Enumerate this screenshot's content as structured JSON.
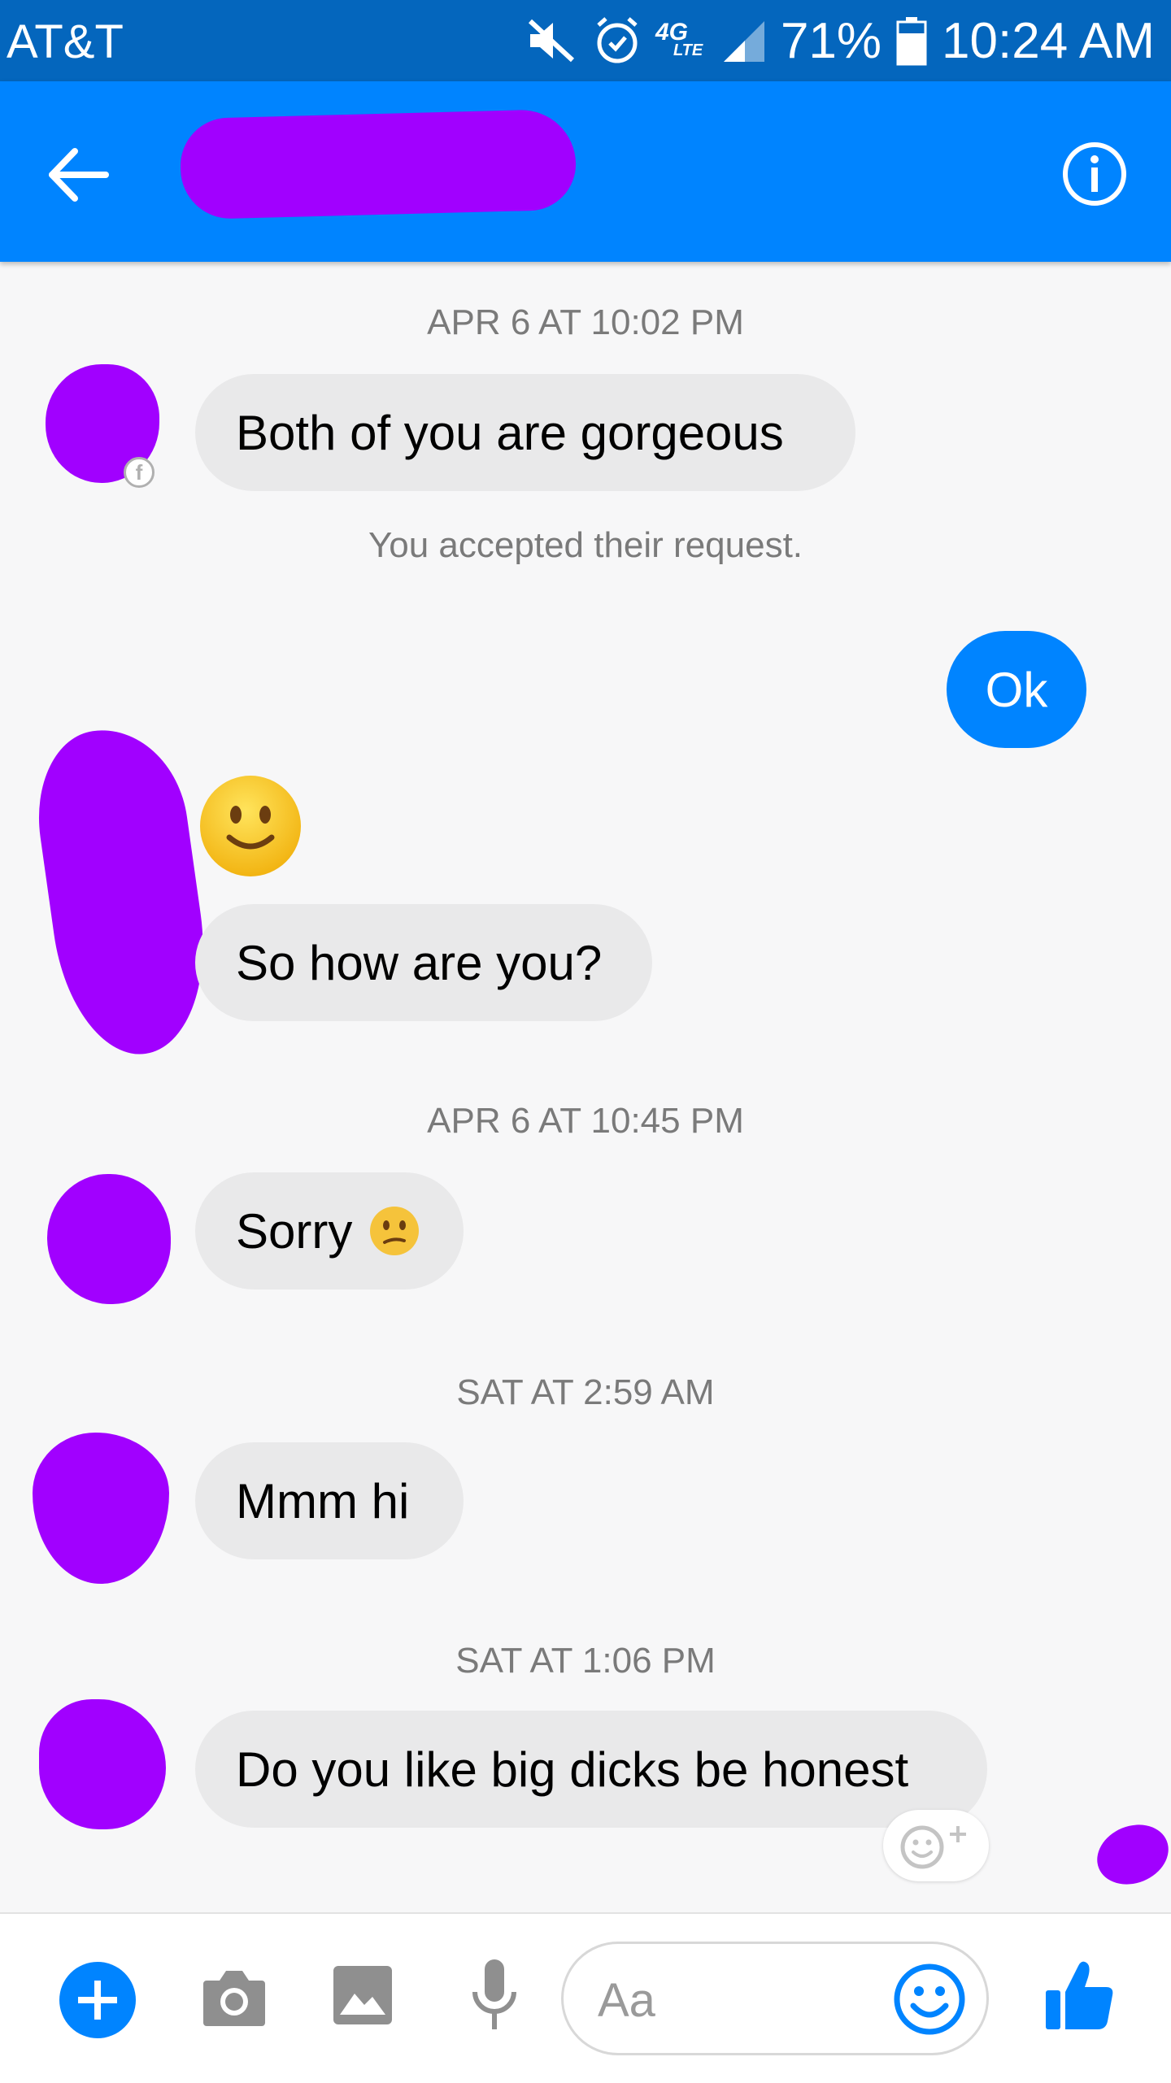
{
  "status_bar": {
    "carrier": "AT&T",
    "network": "4G",
    "network_sub": "LTE",
    "battery": "71%",
    "time": "10:24 AM",
    "icons": [
      "mute-icon",
      "alarm-icon",
      "signal-icon",
      "battery-icon"
    ]
  },
  "header": {
    "contact_name": "",
    "back_icon": "back-arrow-icon",
    "info_icon": "info-icon"
  },
  "messages": [
    {
      "type": "timestamp",
      "text": "APR 6 AT 10:02 PM"
    },
    {
      "type": "incoming",
      "text": "Both of you are gorgeous"
    },
    {
      "type": "system",
      "text": "You accepted their request."
    },
    {
      "type": "outgoing",
      "text": "Ok"
    },
    {
      "type": "incoming_emoji",
      "emoji": "slightly-smiling-face"
    },
    {
      "type": "incoming",
      "text": "So how are you?"
    },
    {
      "type": "timestamp",
      "text": "APR 6 AT 10:45 PM"
    },
    {
      "type": "incoming",
      "text": "Sorry",
      "emoji": "confused-face"
    },
    {
      "type": "timestamp",
      "text": "SAT AT 2:59 AM"
    },
    {
      "type": "incoming",
      "text": "Mmm hi"
    },
    {
      "type": "timestamp",
      "text": "SAT AT 1:06 PM"
    },
    {
      "type": "incoming",
      "text": "Do you like big dicks be honest"
    }
  ],
  "composer": {
    "placeholder": "Aa",
    "icons": [
      "plus-icon",
      "camera-icon",
      "gallery-icon",
      "microphone-icon",
      "emoji-icon",
      "like-thumb-icon"
    ]
  },
  "colors": {
    "status_bar": "#0466bd",
    "header": "#0084ff",
    "outgoing_bubble": "#0084ff",
    "incoming_bubble": "#e9e9ea",
    "redaction": "#a100ff"
  }
}
